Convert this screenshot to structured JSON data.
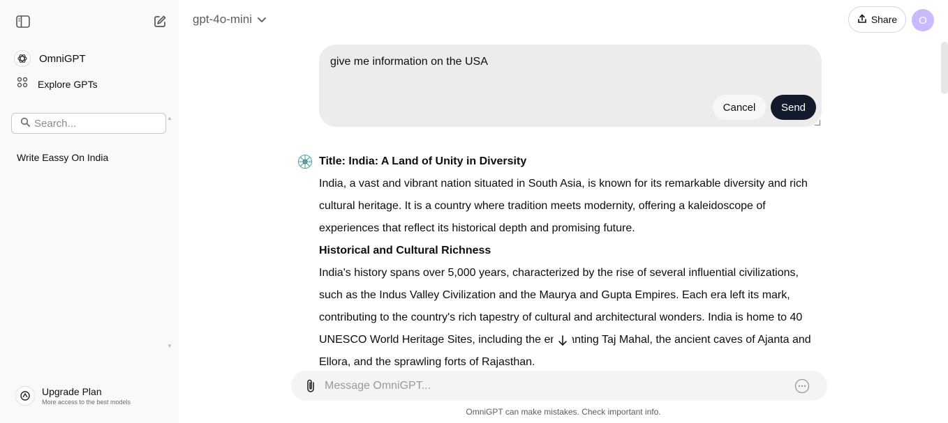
{
  "sidebar": {
    "app_name": "OmniGPT",
    "explore_label": "Explore GPTs",
    "search_placeholder": "Search...",
    "history": [
      "Write Eassy On India"
    ],
    "upgrade_title": "Upgrade Plan",
    "upgrade_subtitle": "More access to the best models"
  },
  "header": {
    "model": "gpt-4o-mini",
    "share_label": "Share",
    "avatar_initial": "O"
  },
  "edit": {
    "text": "give me information on the USA",
    "cancel_label": "Cancel",
    "send_label": "Send"
  },
  "response": {
    "title": "Title: India: A Land of Unity in Diversity",
    "para1": "India, a vast and vibrant nation situated in South Asia, is known for its remarkable diversity and rich cultural heritage. It is a country where tradition meets modernity, offering a kaleidoscope of experiences that reflect its historical depth and promising future.",
    "heading2": "Historical and Cultural Richness",
    "para2": "India's history spans over 5,000 years, characterized by the rise of several influential civilizations, such as the Indus Valley Civilization and the Maurya and Gupta Empires. Each era left its mark, contributing to the country's rich tapestry of cultural and architectural wonders. India is home to 40 UNESCO World Heritage Sites, including the enchanting Taj Mahal, the ancient caves of Ajanta and Ellora, and the sprawling forts of Rajasthan."
  },
  "composer": {
    "placeholder": "Message OmniGPT..."
  },
  "footer": {
    "disclaimer": "OmniGPT can make mistakes. Check important info."
  },
  "colors": {
    "sidebar_bg": "#f9f9f9",
    "send_bg": "#131a2b",
    "avatar_bg": "#c9b9ff"
  }
}
